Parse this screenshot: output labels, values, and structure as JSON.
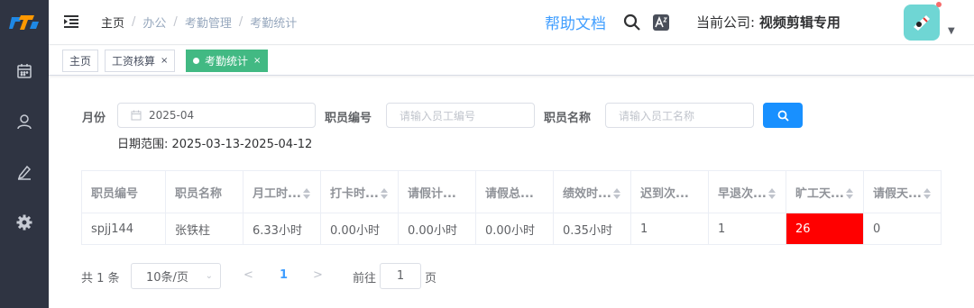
{
  "sidebar": {
    "items": [
      {
        "icon": "calendar-icon"
      },
      {
        "icon": "user-icon"
      },
      {
        "icon": "edit-icon"
      },
      {
        "icon": "gear-icon"
      }
    ]
  },
  "header": {
    "breadcrumb": [
      "主页",
      "办公",
      "考勤管理",
      "考勤统计"
    ],
    "help_label": "帮助文档",
    "company_prefix": "当前公司:",
    "company_name": "视频剪辑专用"
  },
  "tags": [
    {
      "label": "主页",
      "closable": false
    },
    {
      "label": "工资核算",
      "closable": true
    },
    {
      "label": "考勤统计",
      "closable": true,
      "active": true
    }
  ],
  "filters": {
    "month_label": "月份",
    "month_value": "2025-04",
    "emp_id_label": "职员编号",
    "emp_id_placeholder": "请输入员工编号",
    "emp_name_label": "职员名称",
    "emp_name_placeholder": "请输入员工名称",
    "date_range": "日期范围: 2025-03-13-2025-04-12"
  },
  "table": {
    "columns": [
      "职员编号",
      "职员名称",
      "月工时...",
      "打卡时...",
      "请假计...",
      "请假总...",
      "绩效时...",
      "迟到次...",
      "早退次...",
      "旷工天...",
      "请假天..."
    ],
    "rows": [
      [
        "spjj144",
        "张铁柱",
        "6.33小时",
        "0.00小时",
        "0.00小时",
        "0.00小时",
        "0.35小时",
        "1",
        "1",
        "26",
        "0"
      ]
    ]
  },
  "pagination": {
    "total": "共 1 条",
    "page_size": "10条/页",
    "current_page": "1",
    "goto_prefix": "前往",
    "goto_value": "1",
    "goto_suffix": "页"
  },
  "colors": {
    "sidebar": "#2f3442",
    "accent": "#409eff",
    "tag_active": "#42b983",
    "alert": "#ff0000"
  }
}
